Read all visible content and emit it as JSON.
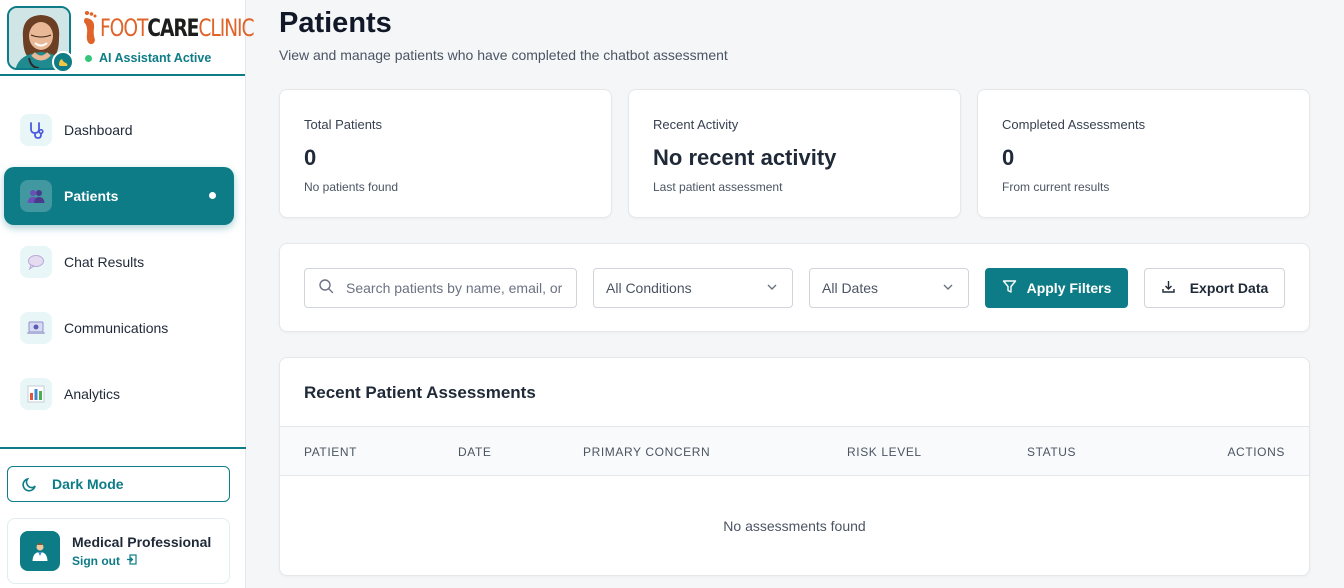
{
  "sidebar": {
    "logo": {
      "foot": "FOOT",
      "care": "CARE",
      "clinic": "CLINIC"
    },
    "ai_status": "AI Assistant Active",
    "nav": [
      {
        "label": "Dashboard",
        "icon": "stethoscope-icon"
      },
      {
        "label": "Patients",
        "icon": "users-icon",
        "active": true
      },
      {
        "label": "Chat Results",
        "icon": "chat-bubble-icon"
      },
      {
        "label": "Communications",
        "icon": "laptop-icon"
      },
      {
        "label": "Analytics",
        "icon": "bar-chart-icon"
      }
    ],
    "dark_mode_label": "Dark Mode",
    "profile": {
      "name": "Medical Professional",
      "signout": "Sign out"
    }
  },
  "page": {
    "title": "Patients",
    "subtitle": "View and manage patients who have completed the chatbot assessment"
  },
  "stats": [
    {
      "label": "Total Patients",
      "value": "0",
      "note": "No patients found"
    },
    {
      "label": "Recent Activity",
      "value": "No recent activity",
      "note": "Last patient assessment"
    },
    {
      "label": "Completed Assessments",
      "value": "0",
      "note": "From current results"
    }
  ],
  "filters": {
    "search_placeholder": "Search patients by name, email, or phone",
    "condition_selected": "All Conditions",
    "date_selected": "All Dates",
    "apply_label": "Apply Filters",
    "export_label": "Export Data"
  },
  "table": {
    "title": "Recent Patient Assessments",
    "columns": [
      "PATIENT",
      "DATE",
      "PRIMARY CONCERN",
      "RISK LEVEL",
      "STATUS",
      "ACTIONS"
    ],
    "empty_message": "No assessments found"
  },
  "colors": {
    "accent": "#0e7c86",
    "logo_orange": "#e0632a",
    "status_green": "#34c77b"
  }
}
